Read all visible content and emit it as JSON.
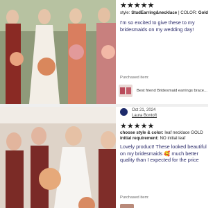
{
  "reviews": [
    {
      "stars": "★★★★★",
      "style_label": "style:",
      "style_value": "StudEarring&necklace",
      "color_label": "COLOR:",
      "color_value": "Gold",
      "text": "I'm so excited to give these to my bridesmaids on my wedding day!",
      "purchased_label": "Purchased item:",
      "product_name": "Best friend Bridesmaid earrings brace..."
    },
    {
      "date": "Oct 21, 2024",
      "reviewer": "Laura Bontoft",
      "stars": "★★★★★",
      "style_label": "choose style & color:",
      "style_value": "leaf necklace GOLD",
      "init_label": "initial requirement:",
      "init_value": "NO initial leaf",
      "text": "Lovely product! These looked beautiful on my bridesmaids 🥰 much better quality than I expected for the price",
      "purchased_label": "Purchased item:"
    }
  ],
  "colors": {
    "review_text": "#2a2a6a",
    "avatar": "#1d2a6b",
    "divider": "#efefef"
  }
}
